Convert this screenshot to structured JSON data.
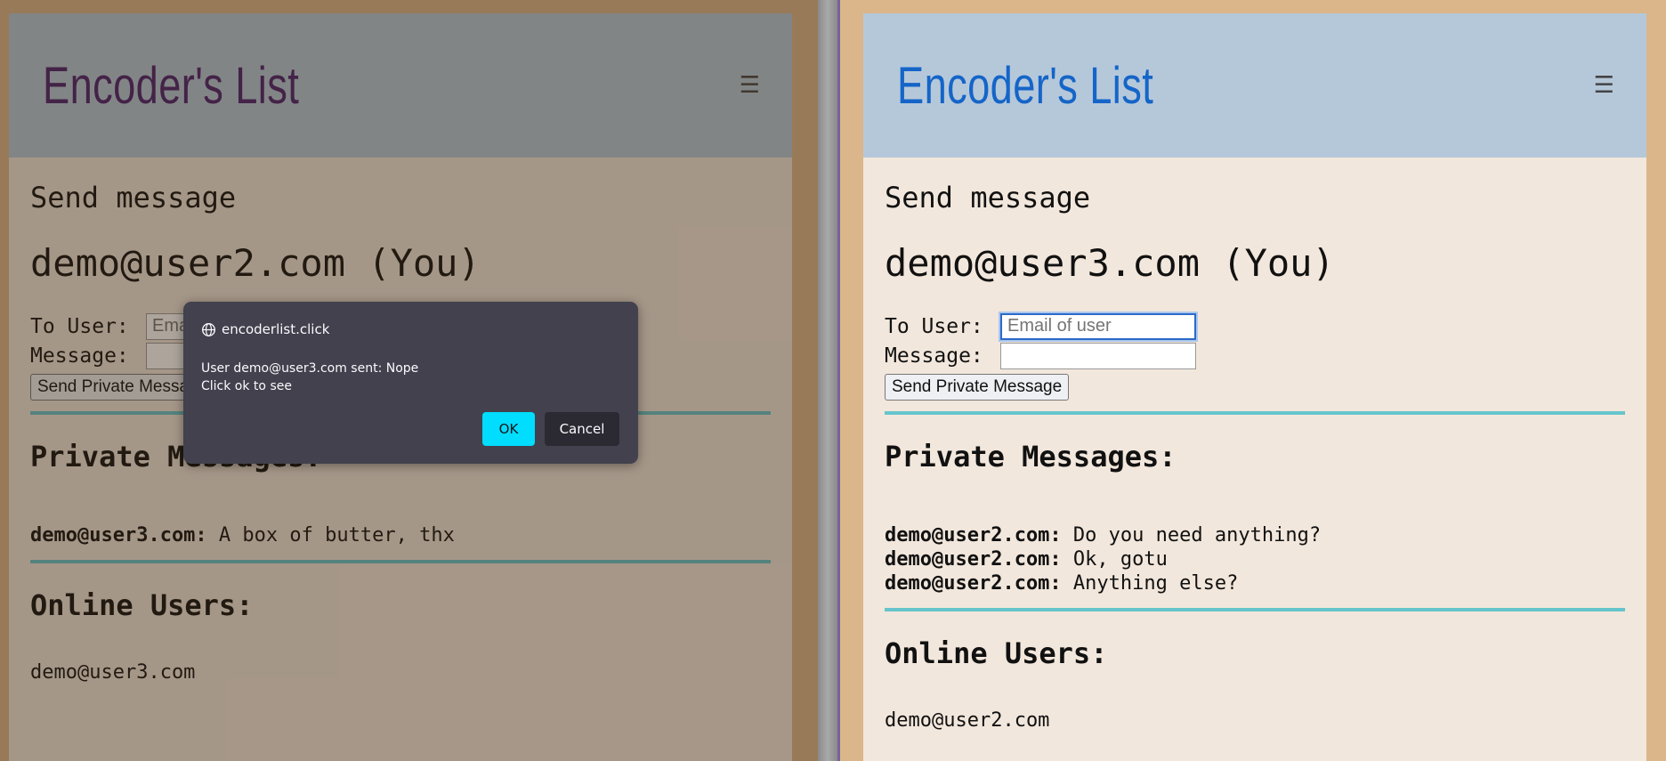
{
  "left_window": {
    "brand": "Encoder's List",
    "menu_icon": "☰",
    "send_heading": "Send message",
    "current_user": "demo@user2.com (You)",
    "form": {
      "to_label": "To User:",
      "to_placeholder": "Email of user",
      "message_label": "Message:",
      "send_label": "Send Private Message"
    },
    "private_heading": "Private Messages:",
    "messages": [
      {
        "from": "demo@user3.com:",
        "text": " A box of butter, thx"
      }
    ],
    "online_heading": "Online Users:",
    "online_users": [
      "demo@user3.com"
    ]
  },
  "right_window": {
    "brand": "Encoder's List",
    "menu_icon": "☰",
    "send_heading": "Send message",
    "current_user": "demo@user3.com (You)",
    "form": {
      "to_label": "To User:",
      "to_placeholder": "Email of user",
      "message_label": "Message:",
      "send_label": "Send Private Message"
    },
    "private_heading": "Private Messages:",
    "messages": [
      {
        "from": "demo@user2.com:",
        "text": " Do you need anything?"
      },
      {
        "from": "demo@user2.com:",
        "text": " Ok, gotu"
      },
      {
        "from": "demo@user2.com:",
        "text": " Anything else?"
      }
    ],
    "online_heading": "Online Users:",
    "online_users": [
      "demo@user2.com"
    ]
  },
  "dialog": {
    "origin": "encoderlist.click",
    "line1": "User demo@user3.com sent: Nope",
    "line2": "Click ok to see",
    "ok_label": "OK",
    "cancel_label": "Cancel"
  },
  "colors": {
    "left_brand": "#4a1f6e",
    "right_brand": "#1565c8",
    "divider_rule": "#66c5cc",
    "dialog_bg": "#42414d",
    "ok_button": "#00ddff"
  }
}
